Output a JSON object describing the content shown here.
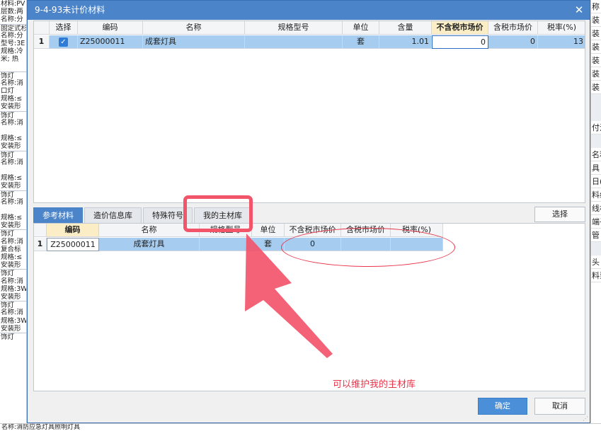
{
  "dialog": {
    "title": "9-4-93未计价材料",
    "confirm_label": "确定",
    "cancel_label": "取消",
    "select_label": "选择"
  },
  "top_grid": {
    "headers": {
      "select": "选择",
      "code": "编码",
      "name": "名称",
      "spec": "规格型号",
      "unit": "单位",
      "qty": "含量",
      "price_ex_tax": "不含税市场价",
      "price_inc_tax": "含税市场价",
      "tax_rate": "税率(%)"
    },
    "rows": [
      {
        "num": "1",
        "checked": "✓",
        "code": "Z25000011",
        "name": "成套灯具",
        "spec": "",
        "unit": "套",
        "qty": "1.01",
        "price_ex_tax": "0",
        "price_inc_tax": "0",
        "tax_rate": "13"
      }
    ]
  },
  "tabs": [
    "参考材料",
    "造价信息库",
    "特殊符号",
    "我的主材库"
  ],
  "bottom_grid": {
    "headers": {
      "code": "编码",
      "name": "名称",
      "spec": "规格型号",
      "unit": "单位",
      "price_ex_tax": "不含税市场价",
      "price_inc_tax": "含税市场价",
      "tax_rate": "税率(%)"
    },
    "rows": [
      {
        "num": "1",
        "code": "Z25000011",
        "name": "成套灯具",
        "spec": "",
        "unit": "套",
        "price_ex_tax": "0",
        "price_inc_tax": "",
        "tax_rate": ""
      }
    ]
  },
  "annotation": {
    "text": "可以维护我的主材库",
    "color": "#e8364a"
  },
  "background": {
    "left_lines": [
      "材料:PV",
      "层数:两",
      "名称:分",
      "固定式杉",
      "名称:分",
      "型号:3E",
      "规格:冷",
      "米; 热",
      "",
      "饰灯",
      "名称:消",
      "口灯",
      "规格:≤",
      "安装形",
      "饰灯",
      "名称:消",
      "",
      "规格:≤",
      "安装形",
      "饰灯",
      "名称:消",
      "",
      "规格:≤",
      "安装形",
      "饰灯",
      "名称:消",
      "",
      "规格:≤",
      "安装形",
      "饰灯",
      "名称:消",
      "复合标",
      "规格:≤",
      "安装形",
      "饰灯",
      "名称:消",
      "规格:3W",
      "安装形",
      "饰灯",
      "名称:消",
      "规格:3W",
      "安装形",
      "饰灯"
    ],
    "right_lines": [
      "称",
      "装",
      "装",
      "装",
      "装",
      "装",
      "装",
      "",
      "",
      "付注",
      "",
      "名利",
      "具",
      "日(",
      "料纠",
      "线机",
      "端子",
      "管",
      "",
      "头",
      "料到"
    ],
    "bottom_text": "名称:消防应急灯具照明灯具"
  }
}
